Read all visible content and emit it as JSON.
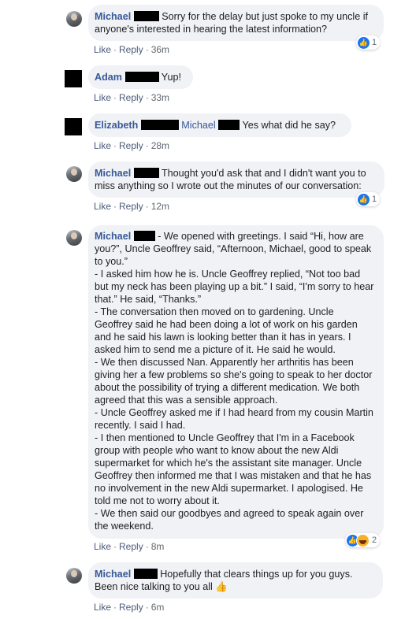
{
  "actions": {
    "like": "Like",
    "reply": "Reply",
    "separator": "·"
  },
  "comments": [
    {
      "name": "Michael",
      "text": "Sorry for the delay but just spoke to my uncle if anyone's interested in hearing the latest information?",
      "time": "36m",
      "reaction_count": "1"
    },
    {
      "name": "Adam",
      "text": "Yup!",
      "time": "33m"
    },
    {
      "name": "Elizabeth",
      "mention": "Michael",
      "text": "Yes what did he say?",
      "time": "28m"
    },
    {
      "name": "Michael",
      "text": "Thought you'd ask that and I didn't want you to miss anything so I wrote out the minutes of our conversation:",
      "time": "12m",
      "reaction_count": "1"
    },
    {
      "name": "Michael",
      "text_lines": [
        "- We opened with greetings. I said “Hi, how are you?”, Uncle Geoffrey said, “Afternoon, Michael, good to speak to you.”",
        "- I asked him how he is. Uncle Geoffrey replied, “Not too bad but my neck has been playing up a bit.” I said, “I'm sorry to hear that.” He said, “Thanks.”",
        "- The conversation then moved on to gardening. Uncle Geoffrey said he had been doing a lot of work on his garden and he said his lawn is looking better than it has in years. I asked him to send me a picture of it. He said he would.",
        "- We then discussed Nan. Apparently her arthritis has been giving her a few problems so she's going to speak to her doctor about the possibility of trying a different medication. We both agreed that this was a sensible approach.",
        "- Uncle Geoffrey asked me if I had heard from my cousin Martin recently. I said I had.",
        "- I then mentioned to Uncle Geoffrey that I'm in a Facebook group with people who want to know about the new Aldi supermarket for which he's the assistant site manager. Uncle Geoffrey then informed me that I was mistaken and that he has no involvement in the new Aldi supermarket. I apologised. He told me not to worry about it.",
        "- We then said our goodbyes and agreed to speak again over the weekend."
      ],
      "time": "8m",
      "reaction_count": "2"
    },
    {
      "name": "Michael",
      "text": "Hopefully that clears things up for you guys. Been nice talking to you all 👍",
      "time": "6m"
    }
  ]
}
